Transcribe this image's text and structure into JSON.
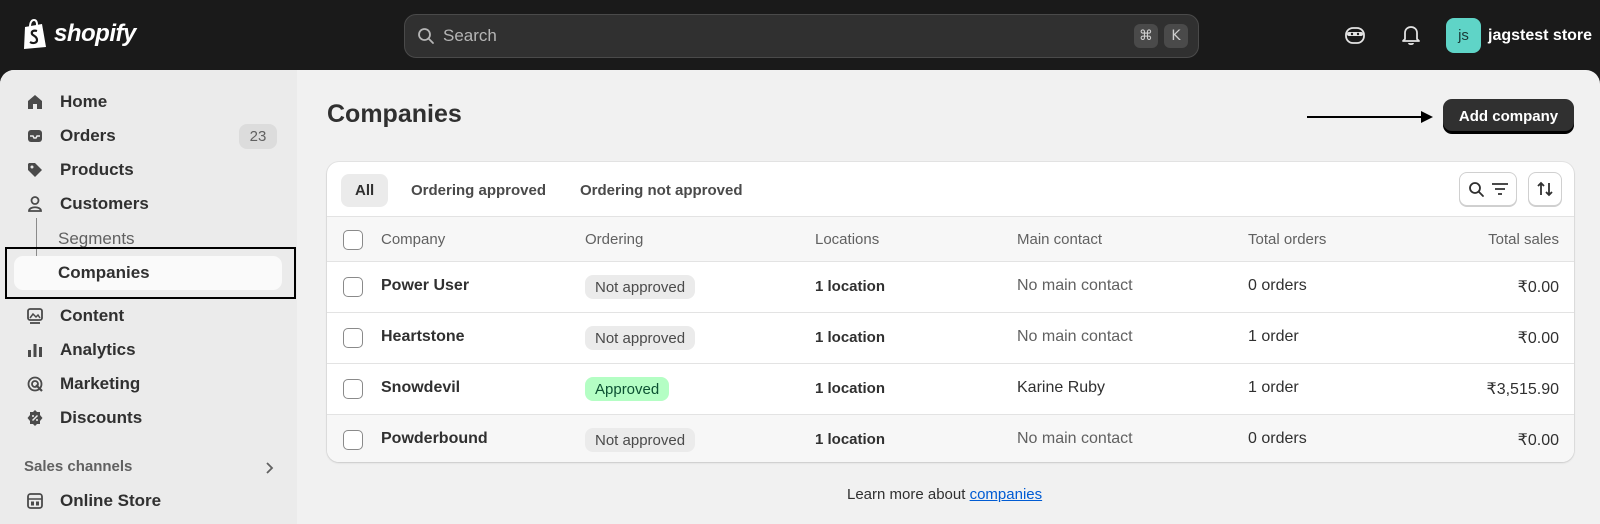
{
  "topbar": {
    "brand": "shopify",
    "search_placeholder": "Search",
    "shortcut_keys": [
      "⌘",
      "K"
    ],
    "store_initials": "js",
    "store_name": "jagstest store",
    "avatar_color": "#5fd4c7"
  },
  "sidebar": {
    "items": [
      {
        "label": "Home",
        "icon": "home-icon"
      },
      {
        "label": "Orders",
        "icon": "inbox-icon",
        "badge": "23"
      },
      {
        "label": "Products",
        "icon": "tag-icon"
      },
      {
        "label": "Customers",
        "icon": "person-icon"
      }
    ],
    "sub_items": [
      {
        "label": "Segments"
      },
      {
        "label": "Companies",
        "active": true
      }
    ],
    "items_after": [
      {
        "label": "Content",
        "icon": "image-icon"
      },
      {
        "label": "Analytics",
        "icon": "bar-chart-icon"
      },
      {
        "label": "Marketing",
        "icon": "target-icon"
      },
      {
        "label": "Discounts",
        "icon": "discount-icon"
      }
    ],
    "section_label": "Sales channels",
    "channel": {
      "label": "Online Store",
      "icon": "store-icon"
    }
  },
  "page": {
    "title": "Companies",
    "add_button": "Add company"
  },
  "tabs": [
    {
      "label": "All",
      "active": true
    },
    {
      "label": "Ordering approved"
    },
    {
      "label": "Ordering not approved"
    }
  ],
  "table": {
    "headers": [
      "Company",
      "Ordering",
      "Locations",
      "Main contact",
      "Total orders",
      "Total sales"
    ],
    "rows": [
      {
        "company": "Power User",
        "ordering": "Not approved",
        "approved": false,
        "locations": "1 location",
        "contact": "No main contact",
        "orders": "0 orders",
        "sales": "₹0.00"
      },
      {
        "company": "Heartstone",
        "ordering": "Not approved",
        "approved": false,
        "locations": "1 location",
        "contact": "No main contact",
        "orders": "1 order",
        "sales": "₹0.00"
      },
      {
        "company": "Snowdevil",
        "ordering": "Approved",
        "approved": true,
        "locations": "1 location",
        "contact": "Karine Ruby",
        "orders": "1 order",
        "sales": "₹3,515.90"
      },
      {
        "company": "Powderbound",
        "ordering": "Not approved",
        "approved": false,
        "locations": "1 location",
        "contact": "No main contact",
        "orders": "0 orders",
        "sales": "₹0.00"
      }
    ]
  },
  "footer": {
    "learn_prefix": "Learn more about ",
    "learn_link": "companies"
  }
}
